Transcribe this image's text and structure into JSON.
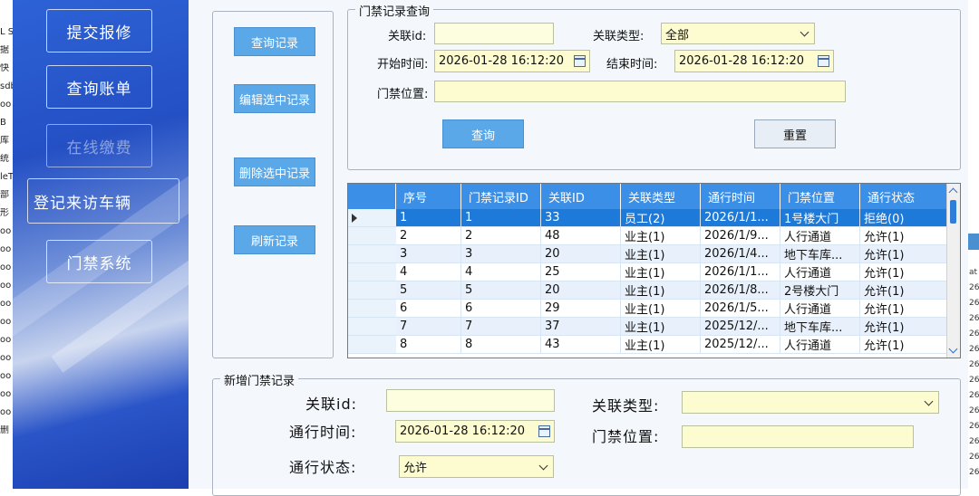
{
  "left_strip": [
    "L S",
    "据",
    "快",
    "sdb",
    "oo",
    "B",
    "库",
    "统",
    "leT",
    "部",
    "形",
    "oo",
    "oo",
    "oo",
    "oo",
    "oo",
    "oo",
    "oo",
    "oo",
    "oo",
    "oo",
    "oo",
    "删"
  ],
  "sidebar": {
    "buttons": [
      {
        "label": "提交报修"
      },
      {
        "label": "查询账单"
      },
      {
        "label": "在线缴费"
      },
      {
        "label": "登记来访车辆"
      },
      {
        "label": "门禁系统"
      }
    ]
  },
  "actions": {
    "query": "查询记录",
    "edit": "编辑选中记录",
    "delete": "删除选中记录",
    "refresh": "刷新记录"
  },
  "search": {
    "title": "门禁记录查询",
    "id_label": "关联id:",
    "id_value": "",
    "type_label": "关联类型:",
    "type_value": "全部",
    "start_label": "开始时间:",
    "start_value": "2026-01-28  16:12:20",
    "end_label": "结束时间:",
    "end_value": "2026-01-28  16:12:20",
    "location_label": "门禁位置:",
    "location_value": "",
    "query_btn": "查询",
    "reset_btn": "重置"
  },
  "grid": {
    "columns": [
      "序号",
      "门禁记录ID",
      "关联ID",
      "关联类型",
      "通行时间",
      "门禁位置",
      "通行状态"
    ],
    "rows": [
      [
        "1",
        "1",
        "33",
        "员工(2)",
        "2026/1/1...",
        "1号楼大门",
        "拒绝(0)"
      ],
      [
        "2",
        "2",
        "48",
        "业主(1)",
        "2026/1/9...",
        "人行通道",
        "允许(1)"
      ],
      [
        "3",
        "3",
        "20",
        "业主(1)",
        "2026/1/4...",
        "地下车库...",
        "允许(1)"
      ],
      [
        "4",
        "4",
        "25",
        "业主(1)",
        "2026/1/1...",
        "人行通道",
        "允许(1)"
      ],
      [
        "5",
        "5",
        "20",
        "业主(1)",
        "2026/1/8...",
        "2号楼大门",
        "允许(1)"
      ],
      [
        "6",
        "6",
        "29",
        "业主(1)",
        "2026/1/5...",
        "人行通道",
        "允许(1)"
      ],
      [
        "7",
        "7",
        "37",
        "业主(1)",
        "2025/12/...",
        "地下车库...",
        "允许(1)"
      ],
      [
        "8",
        "8",
        "43",
        "业主(1)",
        "2025/12/...",
        "人行通道",
        "允许(1)"
      ]
    ]
  },
  "add": {
    "title": "新增门禁记录",
    "id_label": "关联id:",
    "id_value": "",
    "type_label": "关联类型:",
    "type_value": "",
    "time_label": "通行时间:",
    "time_value": "2026-01-28  16:12:20",
    "location_label": "门禁位置:",
    "location_value": "",
    "status_label": "通行状态:",
    "status_value": "允许"
  },
  "right_strip": [
    "at",
    "26",
    "26",
    "26",
    "26",
    "26",
    "26",
    "26",
    "26",
    "26",
    "26",
    "26",
    "26",
    "26"
  ]
}
